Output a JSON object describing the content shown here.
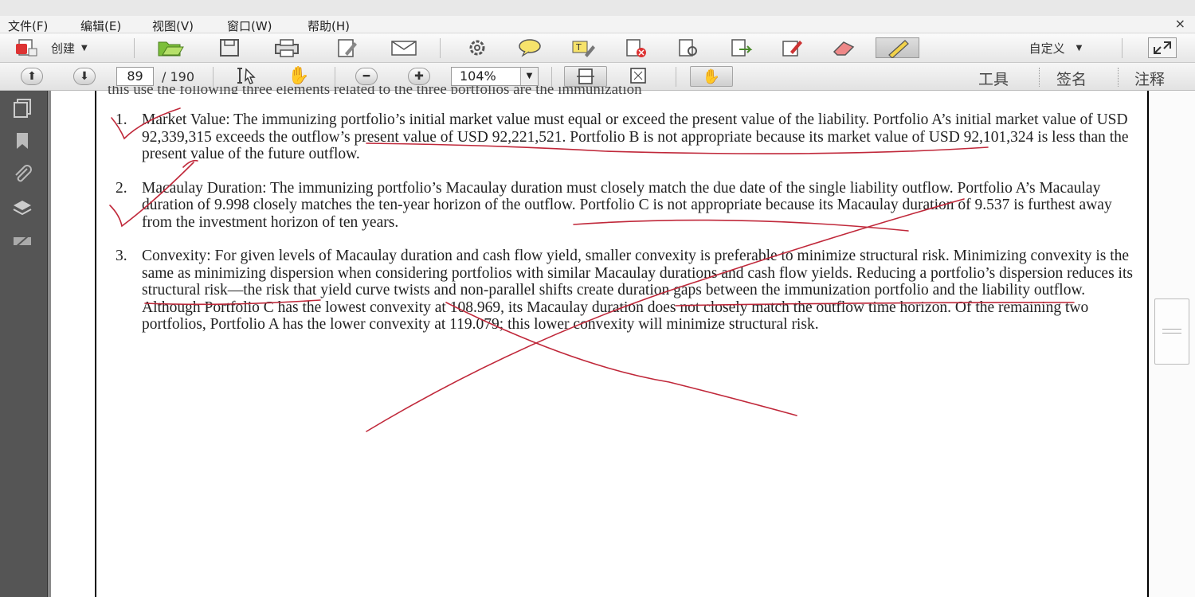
{
  "menu": [
    "文件(F)",
    "编辑(E)",
    "视图(V)",
    "窗口(W)",
    "帮助(H)"
  ],
  "toolbar1": {
    "create_label": "创建",
    "customize_label": "自定义"
  },
  "toolbar2": {
    "page_current": "89",
    "page_total": "/ 190",
    "zoom": "104%",
    "tools_label": "工具",
    "sign_label": "签名",
    "comment_label": "注释"
  },
  "document": {
    "cutoff_line": "this use the following three elements related to the three portfolios are the immunization",
    "items": [
      {
        "num": "1.",
        "text": "Market Value: The immunizing portfolio’s initial market value must equal or exceed the present value of the liability. Portfolio A’s initial market value of USD 92,339,315 exceeds the outflow’s present value of USD 92,221,521. Portfolio B is not appropriate because its market value of USD 92,101,324 is less than the present value of the future outflow."
      },
      {
        "num": "2.",
        "text": "Macaulay Duration: The immunizing portfolio’s Macaulay duration must closely match the due date of the single liability outflow. Portfolio A’s Macaulay duration of 9.998 closely matches the ten-year horizon of the outflow.  Portfolio C is not appropriate because its Macaulay duration of 9.537 is furthest away from the investment horizon of ten years."
      },
      {
        "num": "3.",
        "text": "Convexity: For given levels of Macaulay duration and cash flow yield, smaller convexity is preferable to minimize structural risk. Minimizing convexity is the same as minimizing dispersion when considering portfolios with similar Macaulay durations and cash flow yields. Reducing a portfolio’s dispersion reduces its structural risk—the risk that yield curve twists and non-parallel shifts create duration gaps between the immunization portfolio and the liability outflow. Although Portfolio C has the lowest convexity at 108.969, its Macaulay duration does not closely match the outflow time horizon. Of the remaining two portfolios, Portfolio A has the lower convexity at 119.079; this lower convexity will minimize structural risk."
      }
    ]
  },
  "colors": {
    "annotation": "#c0283a",
    "nav_pane": "#555555"
  }
}
